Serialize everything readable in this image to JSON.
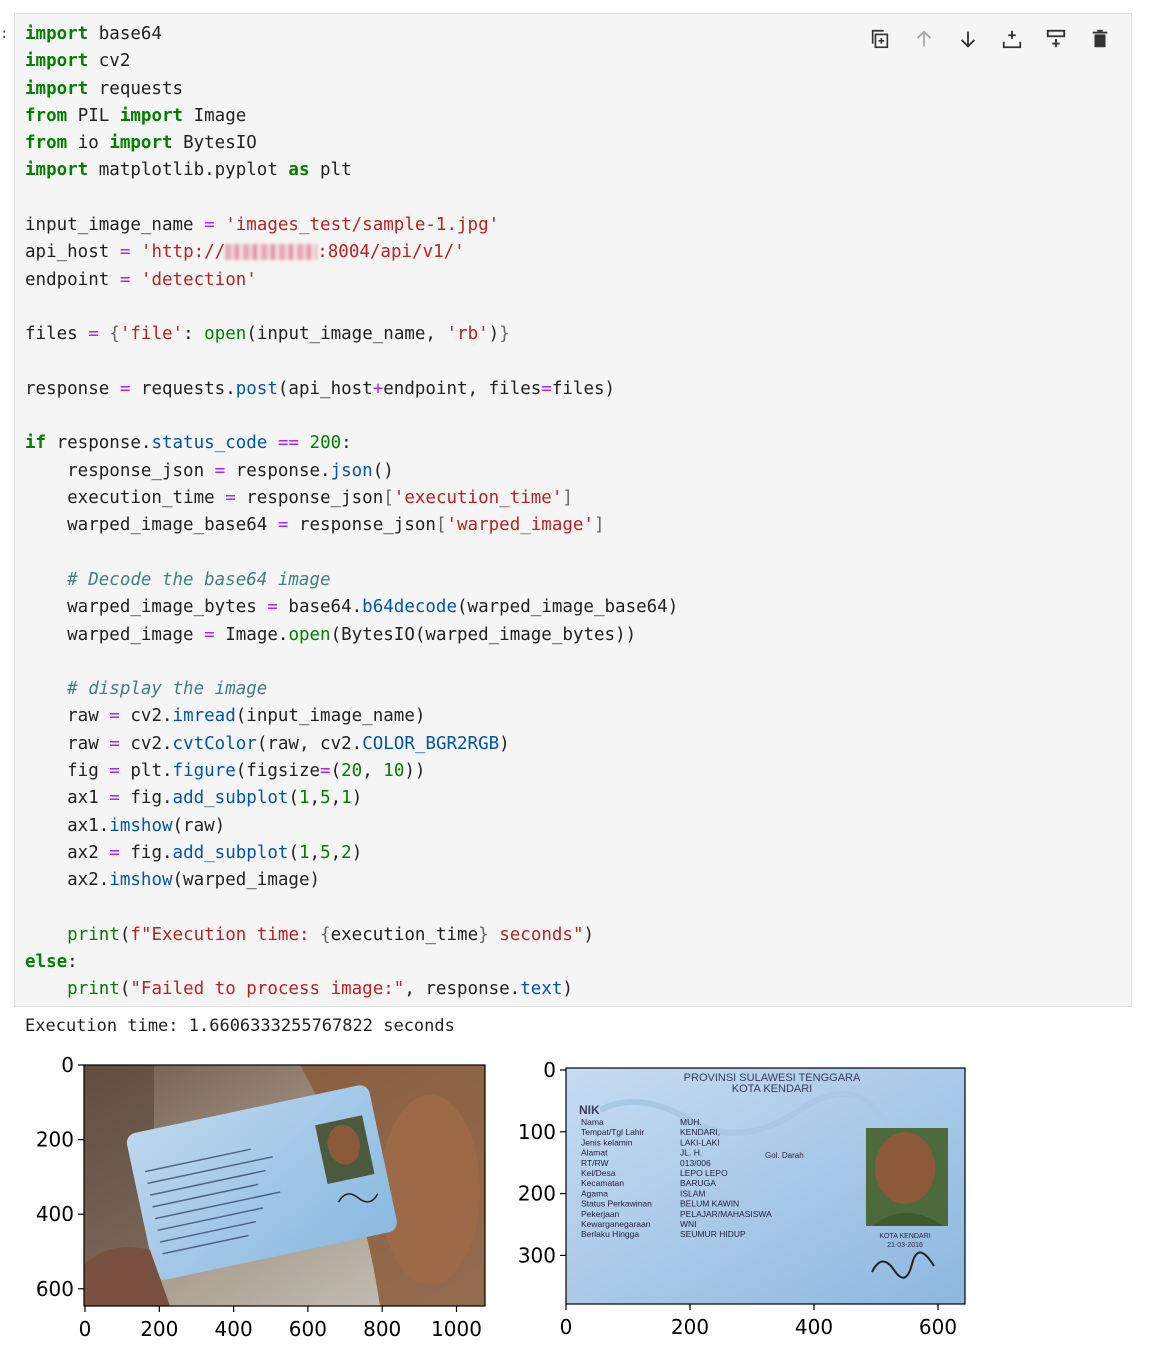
{
  "cell": {
    "marker": ":",
    "code_lines": [
      "import base64",
      "import cv2",
      "import requests",
      "from PIL import Image",
      "from io import BytesIO",
      "import matplotlib.pyplot as plt",
      "",
      "input_image_name = 'images_test/sample-1.jpg'",
      "api_host = 'http://[redacted]:8004/api/v1/'",
      "endpoint = 'detection'",
      "",
      "files = {'file': open(input_image_name, 'rb')}",
      "",
      "response = requests.post(api_host+endpoint, files=files)",
      "",
      "if response.status_code == 200:",
      "    response_json = response.json()",
      "    execution_time = response_json['execution_time']",
      "    warped_image_base64 = response_json['warped_image']",
      "",
      "    # Decode the base64 image",
      "    warped_image_bytes = base64.b64decode(warped_image_base64)",
      "    warped_image = Image.open(BytesIO(warped_image_bytes))",
      "",
      "    # display the image",
      "    raw = cv2.imread(input_image_name)",
      "    raw = cv2.cvtColor(raw, cv2.COLOR_BGR2RGB)",
      "    fig = plt.figure(figsize=(20, 10))",
      "    ax1 = fig.add_subplot(1,5,1)",
      "    ax1.imshow(raw)",
      "    ax2 = fig.add_subplot(1,5,2)",
      "    ax2.imshow(warped_image)",
      "",
      "    print(f\"Execution time: {execution_time} seconds\")",
      "else:",
      "    print(\"Failed to process image:\", response.text)"
    ],
    "toolbar_icons": [
      "duplicate-cell-icon",
      "move-up-icon",
      "move-down-icon",
      "insert-below-icon",
      "insert-above-icon",
      "delete-cell-icon"
    ]
  },
  "output": {
    "text": "Execution time: 1.6606333255767822 seconds",
    "plot1": {
      "yticks": [
        "0",
        "200",
        "400",
        "600"
      ],
      "xticks": [
        "0",
        "200",
        "400",
        "600",
        "800",
        "1000"
      ]
    },
    "plot2": {
      "yticks": [
        "0",
        "100",
        "200",
        "300"
      ],
      "xticks": [
        "0",
        "200",
        "400",
        "600"
      ]
    },
    "card": {
      "province": "PROVINSI SULAWESI TENGGARA",
      "city": "KOTA KENDARI",
      "nik": "NIK",
      "fields": [
        "Nama",
        "Tempat/Tgl Lahir",
        "Jenis kelamin",
        "Alamat",
        "RT/RW",
        "Kel/Desa",
        "Kecamatan",
        "Agama",
        "Status Perkawinan",
        "Pekerjaan",
        "Kewarganegaraan",
        "Berlaku Hingga"
      ],
      "values": [
        "MUH.",
        "KENDARI,",
        "LAKI-LAKI",
        "JL. H.",
        "013/006",
        "LEPO LEPO",
        "BARUGA",
        "ISLAM",
        "BELUM KAWIN",
        "PELAJAR/MAHASISWA",
        "WNI",
        "SEUMUR HIDUP"
      ],
      "blood_type": "Gol. Darah",
      "sign_city": "KOTA KENDARI",
      "sign_date": "21-03-2016"
    }
  }
}
